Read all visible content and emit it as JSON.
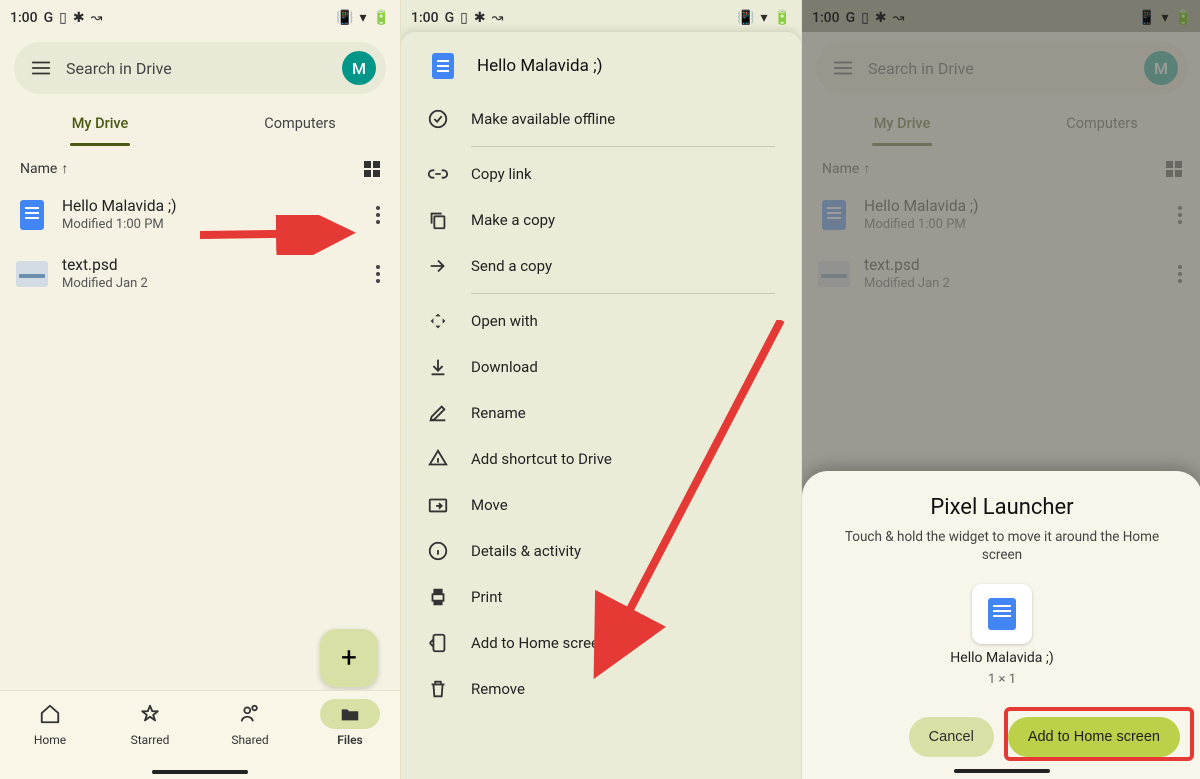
{
  "status": {
    "time": "1:00",
    "glyphs_right": [
      "vibrate",
      "wifi",
      "battery"
    ]
  },
  "search": {
    "placeholder": "Search in Drive",
    "avatar": "M"
  },
  "tabs": {
    "a": "My Drive",
    "b": "Computers"
  },
  "list": {
    "sort": "Name"
  },
  "files": [
    {
      "name": "Hello Malavida ;)",
      "sub": "Modified 1:00 PM",
      "kind": "doc"
    },
    {
      "name": "text.psd",
      "sub": "Modified Jan 2",
      "kind": "psd"
    }
  ],
  "nav": {
    "home": "Home",
    "starred": "Starred",
    "shared": "Shared",
    "files": "Files"
  },
  "sheet": {
    "title": "Hello Malavida ;)",
    "offline": "Make available offline",
    "copy_link": "Copy link",
    "make_copy": "Make a copy",
    "send_copy": "Send a copy",
    "open_with": "Open with",
    "download": "Download",
    "rename": "Rename",
    "shortcut": "Add shortcut to Drive",
    "move": "Move",
    "details": "Details & activity",
    "print": "Print",
    "add_home": "Add to Home screen",
    "remove": "Remove"
  },
  "dialog": {
    "title": "Pixel Launcher",
    "sub": "Touch & hold the widget to move it around the Home screen",
    "wname": "Hello Malavida ;)",
    "wsize": "1 × 1",
    "cancel": "Cancel",
    "add": "Add to Home screen"
  }
}
